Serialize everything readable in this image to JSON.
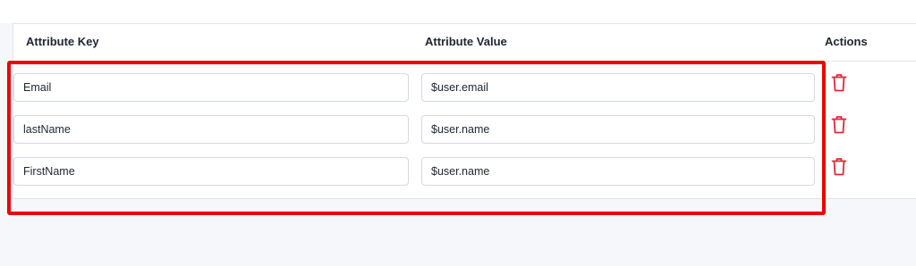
{
  "table": {
    "headers": {
      "key": "Attribute Key",
      "value": "Attribute Value",
      "actions": "Actions"
    },
    "rows": [
      {
        "key": "Email",
        "value": "$user.email",
        "action_icon": "trash-icon"
      },
      {
        "key": "lastName",
        "value": "$user.name",
        "action_icon": "trash-icon"
      },
      {
        "key": "FirstName",
        "value": "$user.name",
        "action_icon": "trash-icon"
      }
    ]
  },
  "colors": {
    "delete_icon": "#e0283a",
    "highlight_border": "#ee0000",
    "header_text": "#1f2430"
  }
}
